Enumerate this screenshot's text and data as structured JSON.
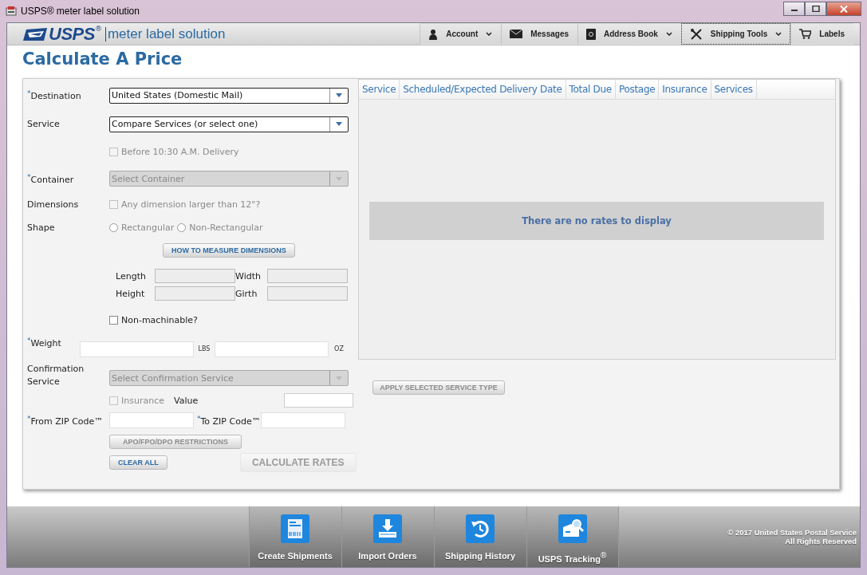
{
  "window": {
    "title": "USPS® meter label solution"
  },
  "header": {
    "logo": "USPS",
    "logo_mark": "®",
    "app_name": "meter label solution",
    "nav": [
      {
        "label": "Account",
        "kind": "person",
        "dropdown": true,
        "selected": false
      },
      {
        "label": "Messages",
        "kind": "envelope",
        "dropdown": false,
        "selected": false
      },
      {
        "label": "Address Book",
        "kind": "book",
        "dropdown": true,
        "selected": false
      },
      {
        "label": "Shipping Tools",
        "kind": "tools",
        "dropdown": true,
        "selected": true
      },
      {
        "label": "Labels",
        "kind": "cart",
        "dropdown": false,
        "selected": false
      }
    ]
  },
  "page_title": "Calculate A Price",
  "form": {
    "destination": {
      "label": "$^{*}$Destination",
      "value": "United States (Domestic Mail)",
      "disabled": false
    },
    "service": {
      "label": "Service",
      "value": "Compare Services (or select one)",
      "disabled": false
    },
    "before_1030": {
      "label": "Before 10:30 A.M. Delivery",
      "checked": false,
      "disabled": true
    },
    "container": {
      "label": "$^{*}$Container",
      "value": "Select Container",
      "disabled": true
    },
    "dimensions": {
      "label": "Dimensions",
      "checkbox_label": "Any dimension larger than 12\"?",
      "checked": false,
      "disabled": true
    },
    "shape": {
      "label": "Shape",
      "disabled": true,
      "options": [
        {
          "label": "Rectangular",
          "selected": false
        },
        {
          "label": "Non-Rectangular",
          "selected": false
        }
      ]
    },
    "measure_button": "HOW TO MEASURE DIMENSIONS",
    "dimension_fields": [
      {
        "label": "Length",
        "disabled": true
      },
      {
        "label": "Width",
        "disabled": true
      },
      {
        "label": "Height",
        "disabled": true
      },
      {
        "label": "Girth",
        "disabled": true
      }
    ],
    "non_machinable": {
      "label": "Non-machinable?",
      "checked": false,
      "disabled": false
    },
    "weight": {
      "label": "$^{*}$Weight",
      "units": [
        "LBS",
        "OZ"
      ]
    },
    "confirmation": {
      "label": "Confirmation Service",
      "value": "Select Confirmation Service",
      "disabled": true
    },
    "insurance": {
      "label": "Insurance",
      "checked": false,
      "disabled": true,
      "value_label": "Value"
    },
    "from_zip": {
      "label": "$^{*}$From ZIP Code™"
    },
    "to_zip": {
      "label": "$^{*}$To ZIP Code™"
    },
    "apo_button": {
      "label": "APO/FPO/DPO RESTRICTIONS",
      "disabled": true
    },
    "clear_button": {
      "label": "CLEAR ALL",
      "disabled": false
    },
    "calculate_button": {
      "label": "CALCULATE RATES",
      "disabled": true
    }
  },
  "rates": {
    "columns": [
      "Service",
      "Scheduled/Expected Delivery Date",
      "Total Due",
      "Postage",
      "Insurance",
      "Services"
    ],
    "empty_message": "There are no rates to display",
    "apply_button": {
      "label": "APPLY SELECTED SERVICE TYPE",
      "disabled": true
    }
  },
  "footer": {
    "items": [
      {
        "label": "Create Shipments",
        "kind": "label"
      },
      {
        "label": "Import Orders",
        "kind": "import"
      },
      {
        "label": "Shipping History",
        "kind": "history"
      },
      {
        "label": "USPS Tracking$^{®}$",
        "kind": "tracking"
      }
    ],
    "copyright": [
      "© 2017 United States Postal Service",
      "All Rights Reserved"
    ]
  }
}
